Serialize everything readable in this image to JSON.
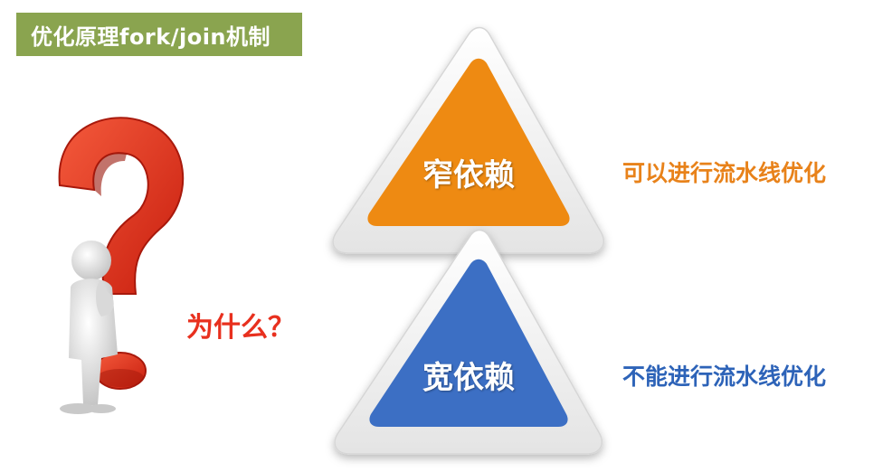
{
  "title": "优化原理fork/join机制",
  "question": "为什么？",
  "narrow": {
    "label": "窄依赖",
    "description": "可以进行流水线优化",
    "color": "#ee8a12",
    "text_color": "#e8821a"
  },
  "wide": {
    "label": "宽依赖",
    "description": "不能进行流水线优化",
    "color": "#3c6fc4",
    "text_color": "#2d63b8"
  },
  "icons": {
    "question_mark": "question-mark-icon",
    "thinking_figure": "thinking-person-icon"
  },
  "colors": {
    "banner": "#8aa44f",
    "question_red": "#e8301e"
  }
}
